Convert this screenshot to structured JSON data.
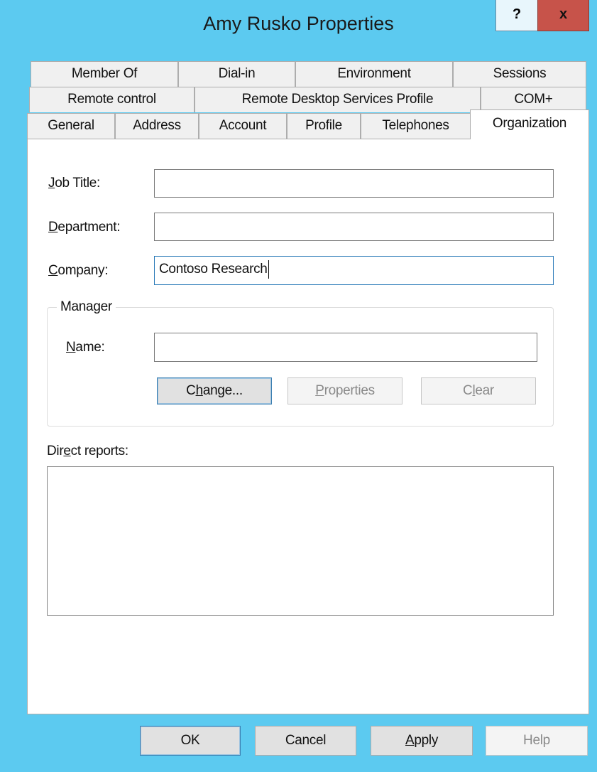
{
  "window": {
    "title": "Amy Rusko Properties",
    "help_label": "?",
    "close_label": "x"
  },
  "tabs": {
    "row1": [
      "Member Of",
      "Dial-in",
      "Environment",
      "Sessions"
    ],
    "row2": [
      "Remote control",
      "Remote Desktop Services Profile",
      "COM+"
    ],
    "row3": [
      "General",
      "Address",
      "Account",
      "Profile",
      "Telephones",
      "Organization"
    ],
    "active": "Organization"
  },
  "form": {
    "job_title": {
      "label_u": "J",
      "label_rest": "ob Title:",
      "value": ""
    },
    "department": {
      "label_u": "D",
      "label_rest": "epartment:",
      "value": ""
    },
    "company": {
      "label_u": "C",
      "label_rest": "ompany:",
      "value": "Contoso Research"
    }
  },
  "manager": {
    "group_title": "Manager",
    "name_label_u": "N",
    "name_label_rest": "ame:",
    "name_value": "",
    "change_pre": "C",
    "change_u": "h",
    "change_post": "ange...",
    "properties_u": "P",
    "properties_rest": "roperties",
    "clear_pre": "C",
    "clear_u": "l",
    "clear_post": "ear"
  },
  "direct_reports": {
    "label_pre": "Dir",
    "label_u": "e",
    "label_post": "ct reports:"
  },
  "footer": {
    "ok_label": "OK",
    "cancel_label": "Cancel",
    "apply_u": "A",
    "apply_rest": "pply",
    "help_label": "Help"
  }
}
